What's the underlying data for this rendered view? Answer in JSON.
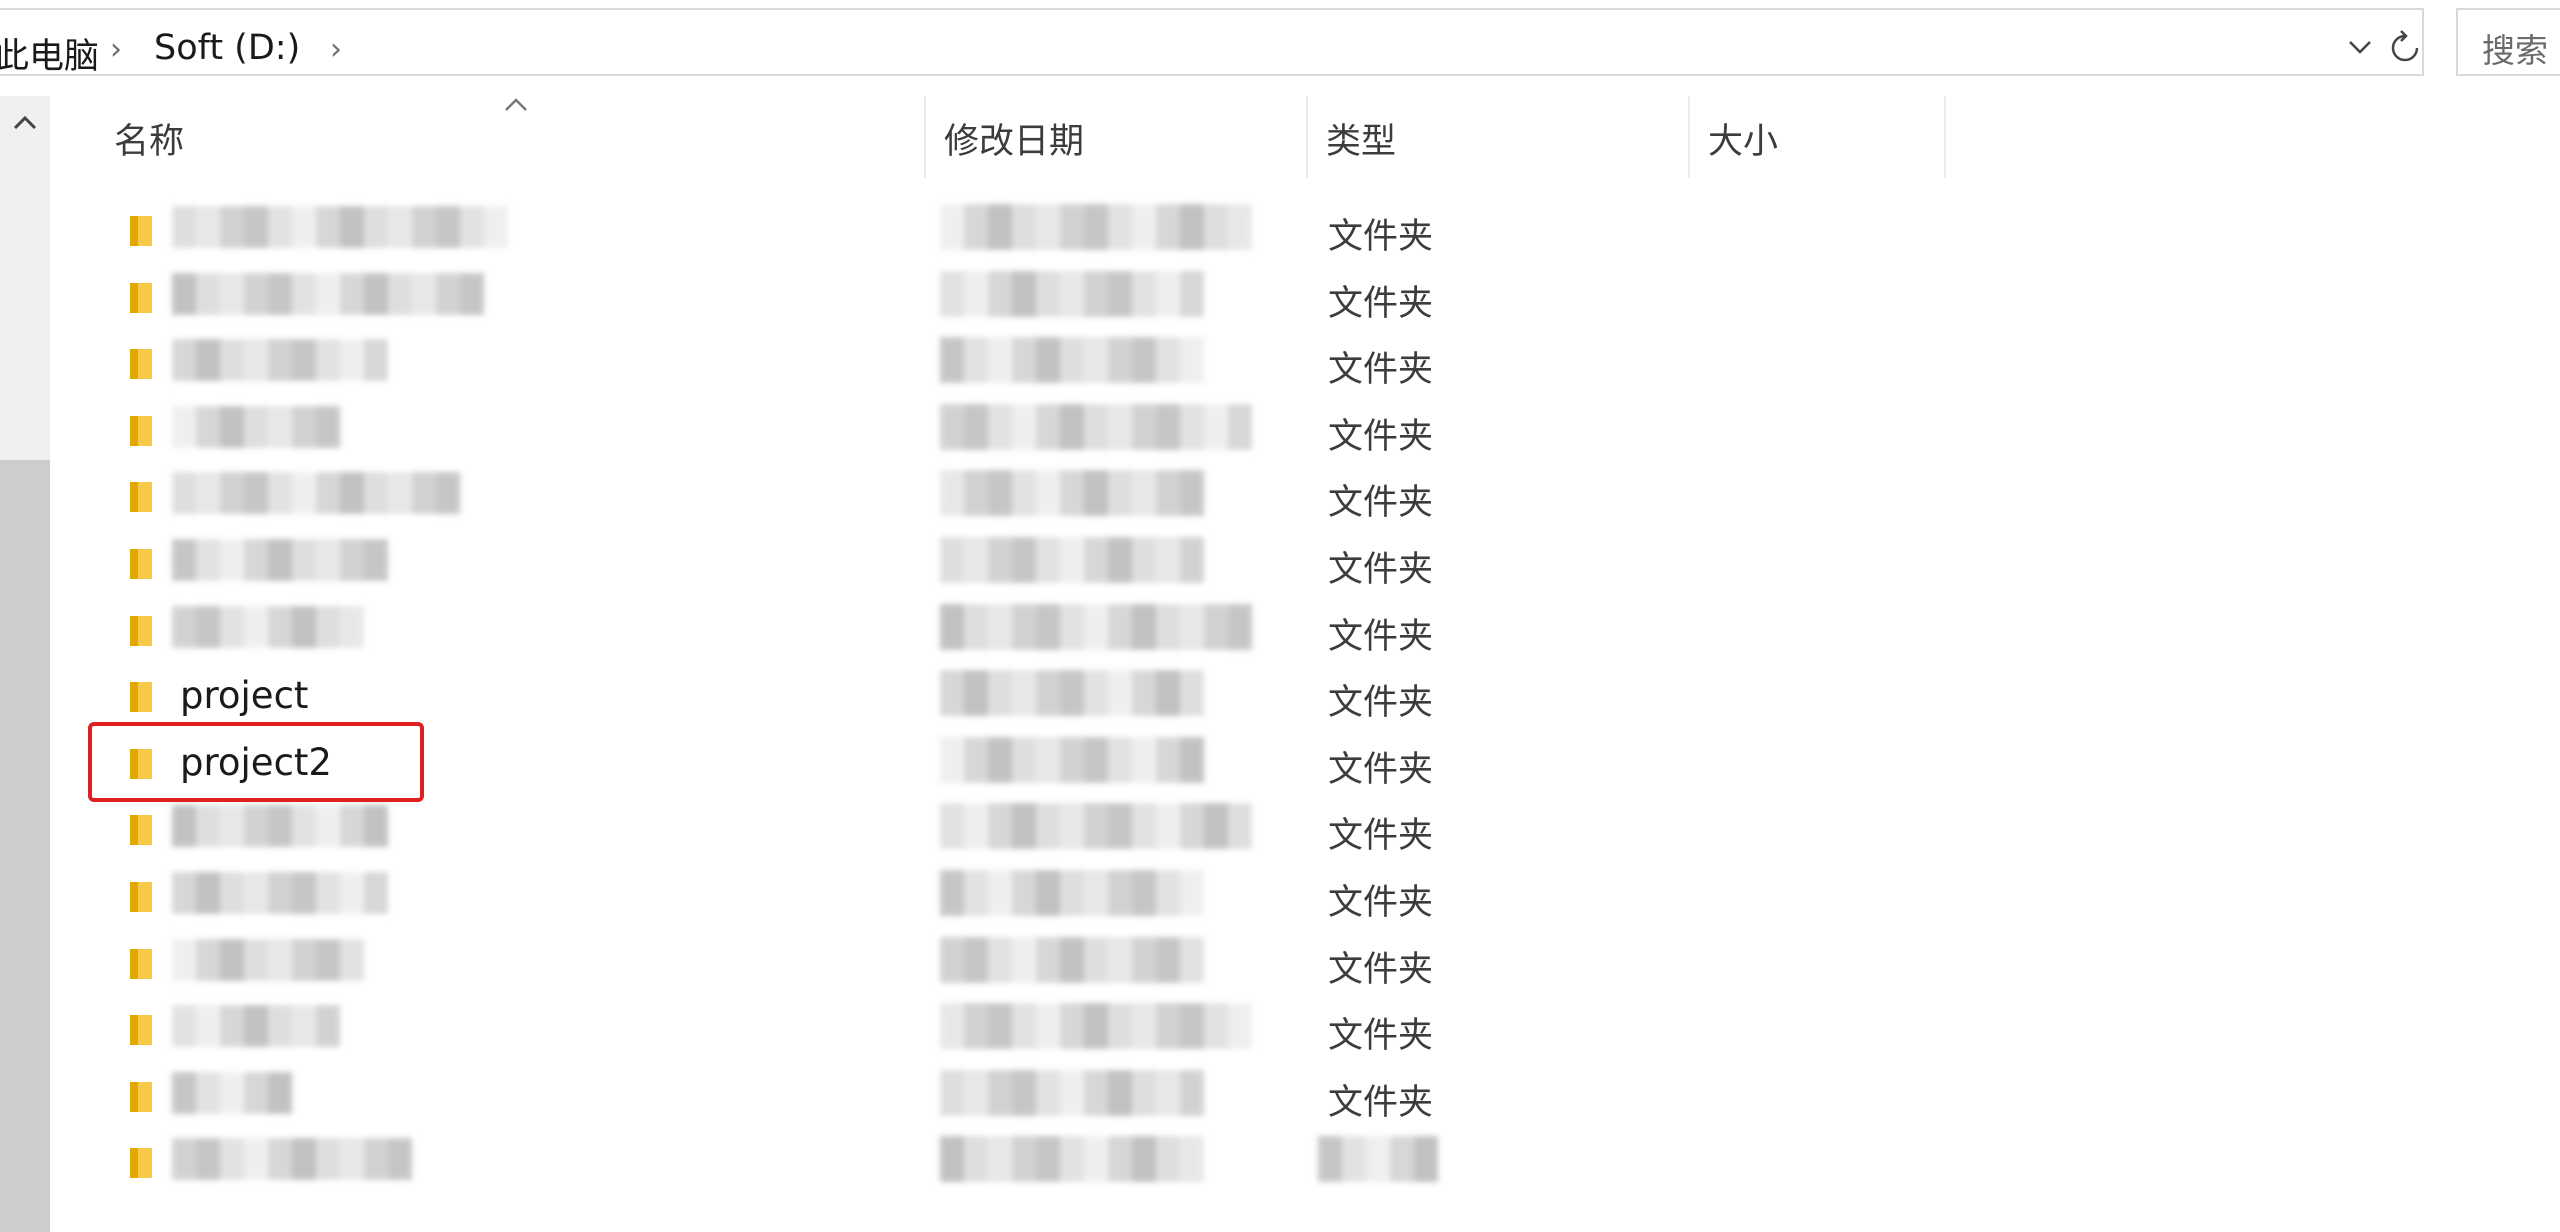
{
  "window": {
    "title": ""
  },
  "address_bar": {
    "breadcrumbs": [
      "此电脑",
      "Soft (D:)"
    ],
    "search_placeholder": "搜索"
  },
  "columns": [
    {
      "key": "name",
      "label": "名称"
    },
    {
      "key": "modified",
      "label": "修改日期"
    },
    {
      "key": "type",
      "label": "类型"
    },
    {
      "key": "size",
      "label": "大小"
    }
  ],
  "rows": [
    {
      "name": "",
      "modified": "",
      "type": "文件夹"
    },
    {
      "name": "",
      "modified": "",
      "type": "文件夹"
    },
    {
      "name": "",
      "modified": "",
      "type": "文件夹"
    },
    {
      "name": "",
      "modified": "",
      "type": "文件夹"
    },
    {
      "name": "",
      "modified": "",
      "type": "文件夹"
    },
    {
      "name": "",
      "modified": "",
      "type": "文件夹"
    },
    {
      "name": "",
      "modified": "",
      "type": "文件夹"
    },
    {
      "name": "project",
      "modified": "",
      "type": "文件夹"
    },
    {
      "name": "project2",
      "modified": "",
      "type": "文件夹",
      "highlighted": true
    },
    {
      "name": "",
      "modified": "",
      "type": "文件夹"
    },
    {
      "name": "",
      "modified": "",
      "type": "文件夹"
    },
    {
      "name": "",
      "modified": "",
      "type": "文件夹"
    },
    {
      "name": "",
      "modified": "",
      "type": "文件夹"
    },
    {
      "name": "",
      "modified": "",
      "type": "文件夹"
    },
    {
      "name": "",
      "modified": "",
      "type": ""
    }
  ],
  "colors": {
    "folder_yellow": "#f7c948",
    "folder_shade": "#e0a800",
    "highlight_red": "#e02020"
  }
}
